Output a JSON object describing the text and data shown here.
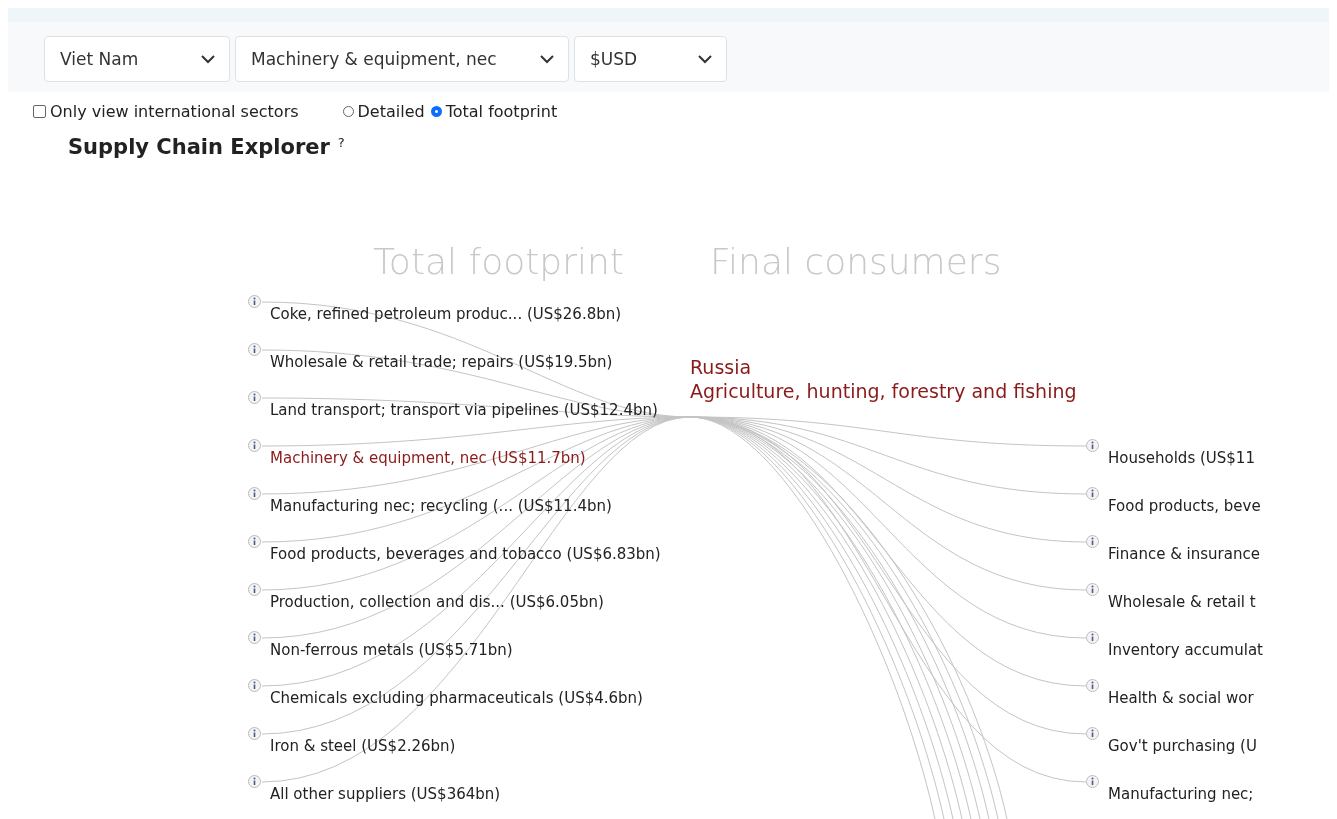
{
  "filters": [
    {
      "value": "Viet Nam"
    },
    {
      "value": "Machinery & equipment, nec"
    },
    {
      "value": "$USD"
    }
  ],
  "options": {
    "international_only": {
      "label": "Only view international sectors",
      "checked": false
    },
    "view_modes": [
      {
        "label": "Detailed",
        "selected": false
      },
      {
        "label": "Total footprint",
        "selected": true
      }
    ]
  },
  "title": "Supply Chain Explorer",
  "help": "?",
  "diagram": {
    "left_heading": "Total footprint",
    "right_heading": "Final consumers",
    "focus": {
      "country": "Russia",
      "sector": "Agriculture, hunting, forestry and fishing"
    },
    "suppliers": [
      {
        "label": "Coke, refined petroleum produc... (US$26.8bn)",
        "highlighted": false
      },
      {
        "label": "Wholesale & retail trade; repairs (US$19.5bn)",
        "highlighted": false
      },
      {
        "label": "Land transport; transport via pipelines (US$12.4bn)",
        "highlighted": false
      },
      {
        "label": "Machinery & equipment, nec (US$11.7bn)",
        "highlighted": true
      },
      {
        "label": "Manufacturing nec; recycling (... (US$11.4bn)",
        "highlighted": false
      },
      {
        "label": "Food products, beverages and tobacco (US$6.83bn)",
        "highlighted": false
      },
      {
        "label": "Production, collection and dis... (US$6.05bn)",
        "highlighted": false
      },
      {
        "label": "Non-ferrous metals (US$5.71bn)",
        "highlighted": false
      },
      {
        "label": "Chemicals excluding pharmaceuticals (US$4.6bn)",
        "highlighted": false
      },
      {
        "label": "Iron & steel (US$2.26bn)",
        "highlighted": false
      },
      {
        "label": "All other suppliers (US$364bn)",
        "highlighted": false
      }
    ],
    "consumers": [
      {
        "label": "Households (US$11"
      },
      {
        "label": "Food products, beve"
      },
      {
        "label": "Finance & insurance"
      },
      {
        "label": "Wholesale & retail t"
      },
      {
        "label": "Inventory accumulat"
      },
      {
        "label": "Health & social wor"
      },
      {
        "label": "Gov't purchasing (U"
      },
      {
        "label": "Manufacturing nec;"
      }
    ]
  }
}
